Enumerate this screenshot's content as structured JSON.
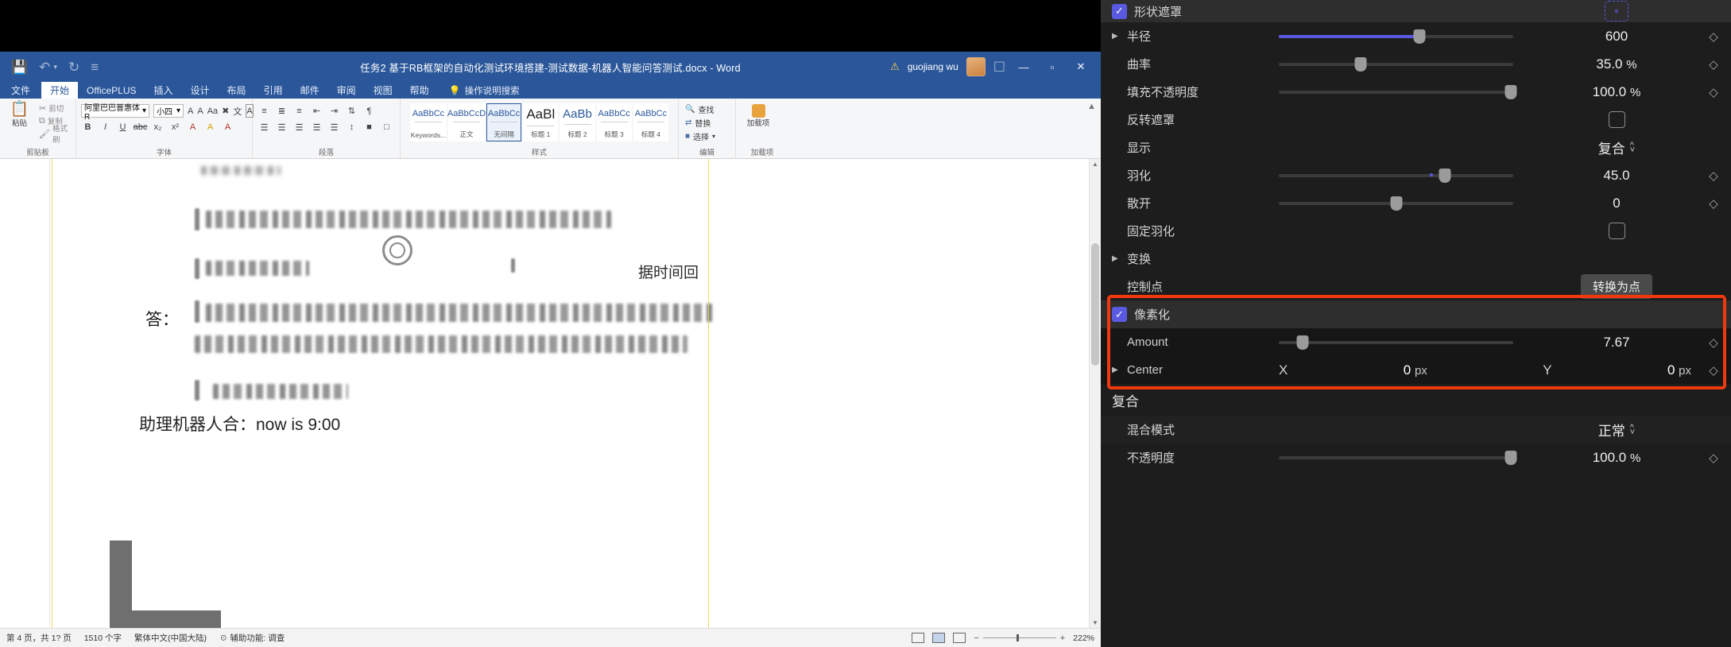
{
  "word": {
    "title": "任务2 基于RB框架的自动化测试环境搭建-测试数据-机器人智能问答测试.docx  -  Word",
    "user": "guojiang wu",
    "quick_access": {
      "save": "save-icon",
      "undo": "undo-icon",
      "redo": "redo-icon",
      "customize": "customize-qat-icon"
    },
    "window_controls": {
      "minimize": "—",
      "maximize": "▫",
      "close": "✕"
    },
    "tabs": [
      "文件",
      "开始",
      "OfficePLUS",
      "插入",
      "设计",
      "布局",
      "引用",
      "邮件",
      "审阅",
      "视图",
      "帮助"
    ],
    "active_tab": "开始",
    "tellme": "操作说明搜索",
    "ribbon": {
      "clipboard": {
        "group_label": "剪贴板",
        "paste": "粘贴",
        "cut": "剪切",
        "copy": "复制",
        "format_painter": "格式刷"
      },
      "font": {
        "group_label": "字体",
        "font_name": "阿里巴巴普惠体 R",
        "font_size": "小四",
        "grow": "A",
        "shrink": "A",
        "case": "Aa",
        "clear_format": "A",
        "bold": "B",
        "italic": "I",
        "underline": "U",
        "strikethrough": "abc",
        "subscript": "x₂",
        "superscript": "x²",
        "text_effects": "A",
        "highlight": "A",
        "font_color": "A",
        "phonetic": "文"
      },
      "paragraph": {
        "group_label": "段落"
      },
      "styles": {
        "group_label": "样式",
        "items": [
          {
            "preview": "AaBbCc",
            "name": "Keywords..."
          },
          {
            "preview": "AaBbCcD",
            "name": "正文"
          },
          {
            "preview": "AaBbCc",
            "name": "无间隔",
            "selected": true
          },
          {
            "preview": "AaBl",
            "name": "标题 1"
          },
          {
            "preview": "AaBb",
            "name": "标题 2"
          },
          {
            "preview": "AaBbCc",
            "name": "标题 3"
          },
          {
            "preview": "AaBbCc",
            "name": "标题 4"
          }
        ]
      },
      "editing": {
        "group_label": "编辑",
        "find": "查找",
        "replace": "替换",
        "select": "选择"
      },
      "addins": {
        "group_label": "加载项",
        "label": "加载项"
      }
    },
    "document": {
      "answer_label": "答：",
      "fragment_time": "据时间回",
      "line_assistant": "助理机器人合：now is 9:00",
      "redacted_note": "document body text is pixelated / blurred"
    },
    "status": {
      "page": "第 4 页，共 1? 页",
      "words": "1510 个字",
      "language": "繁体中文(中国大陆)",
      "accessibility": "辅助功能: 调查",
      "zoom": "222%",
      "zoom_out": "−",
      "zoom_in": "+"
    }
  },
  "panel": {
    "accent_blue": "#5a5ae0",
    "highlight_red": "#f2380f",
    "rows": [
      {
        "name": "shape-mask-header",
        "label": "形状遮罩",
        "checkbox": true,
        "control": "mask-icon"
      },
      {
        "name": "radius",
        "label": "半径",
        "expandable": true,
        "slider": 0.6,
        "filled": true,
        "value": "600",
        "keyframe": true
      },
      {
        "name": "curvature",
        "label": "曲率",
        "slider": 0.35,
        "value": "35.0",
        "unit": "%",
        "keyframe": true
      },
      {
        "name": "fill-opacity",
        "label": "填充不透明度",
        "slider": 1.0,
        "value": "100.0",
        "unit": "%",
        "keyframe": true
      },
      {
        "name": "invert-mask",
        "label": "反转遮罩",
        "square_checkbox": true
      },
      {
        "name": "display",
        "label": "显示",
        "popup": "复合"
      },
      {
        "name": "feather",
        "label": "羽化",
        "slider": 0.72,
        "value": "45.0",
        "keyframe": true
      },
      {
        "name": "spread",
        "label": "散开",
        "slider": 0.5,
        "value": "0",
        "keyframe": true
      },
      {
        "name": "fixed-feather",
        "label": "固定羽化",
        "square_checkbox": true
      },
      {
        "name": "transform",
        "label": "变换",
        "expandable": true
      },
      {
        "name": "control-points",
        "label": "控制点",
        "button": "转换为点"
      }
    ],
    "pixelate": {
      "header": "像素化",
      "checkbox": true,
      "amount": {
        "label": "Amount",
        "slider": 0.08,
        "value": "7.67",
        "keyframe": true
      },
      "center": {
        "label": "Center",
        "x_axis": "X",
        "x_value": "0",
        "x_unit": "px",
        "y_axis": "Y",
        "y_value": "0",
        "y_unit": "px",
        "keyframe": true
      }
    },
    "composite": {
      "title": "复合",
      "blend_mode": {
        "label": "混合模式",
        "value": "正常"
      },
      "opacity": {
        "label": "不透明度",
        "slider": 1.0,
        "value": "100.0",
        "unit": "%",
        "keyframe": true
      }
    }
  }
}
